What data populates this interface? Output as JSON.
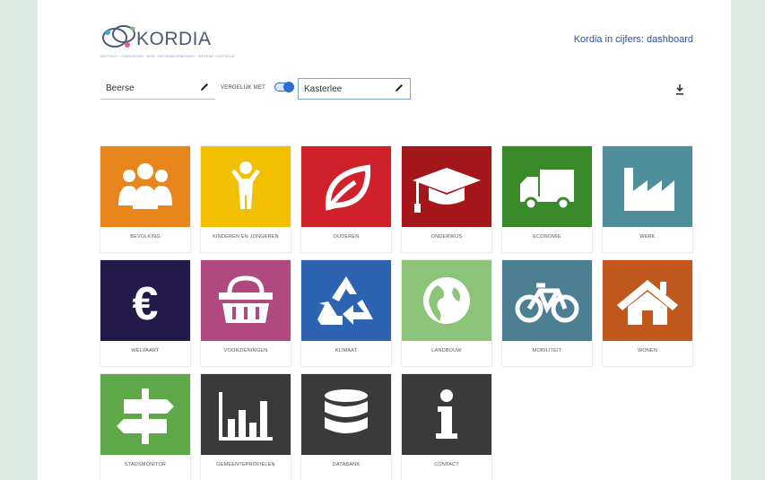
{
  "header": {
    "logo_text": "KORDIA",
    "logo_tagline": "BESTUUR · ONDERZOEK · WEB · INFORMATIEBEHEER · INTERNE CONTROLE",
    "dashboard_link": "Kordia in cijfers: dashboard"
  },
  "filters": {
    "municipality": "Beerse",
    "compare_label": "VERGELIJK MET",
    "compare_enabled": true,
    "compare_municipality": "Kasterlee"
  },
  "tiles": [
    {
      "label": "BEVOLKING",
      "color": "#e8861c",
      "icon": "people-icon"
    },
    {
      "label": "KINDEREN EN JONGEREN",
      "color": "#f2c000",
      "icon": "child-icon"
    },
    {
      "label": "OUDEREN",
      "color": "#d0202a",
      "icon": "leaf-icon"
    },
    {
      "label": "ONDERWIJS",
      "color": "#a5161b",
      "icon": "graduation-cap-icon"
    },
    {
      "label": "ECONOMIE",
      "color": "#3a8a2c",
      "icon": "truck-icon"
    },
    {
      "label": "WERK",
      "color": "#4f8f9c",
      "icon": "factory-icon"
    },
    {
      "label": "WELVAART",
      "color": "#231a4a",
      "icon": "euro-icon"
    },
    {
      "label": "VOORZIENINGEN",
      "color": "#b0497f",
      "icon": "basket-icon"
    },
    {
      "label": "KLIMAAT",
      "color": "#2d63b0",
      "icon": "recycle-icon"
    },
    {
      "label": "LANDBOUW",
      "color": "#8cc47a",
      "icon": "globe-icon"
    },
    {
      "label": "MOBILITEIT",
      "color": "#4d7f93",
      "icon": "bicycle-icon"
    },
    {
      "label": "WONEN",
      "color": "#c0581d",
      "icon": "house-icon"
    },
    {
      "label": "STADSMONITOR",
      "color": "#5fa84a",
      "icon": "signpost-icon"
    },
    {
      "label": "GEMEENTEPROFIELEN",
      "color": "#3a3a3a",
      "icon": "bar-chart-icon"
    },
    {
      "label": "DATABANK",
      "color": "#3a3a3a",
      "icon": "database-icon"
    },
    {
      "label": "CONTACT",
      "color": "#3a3a3a",
      "icon": "info-icon"
    }
  ]
}
